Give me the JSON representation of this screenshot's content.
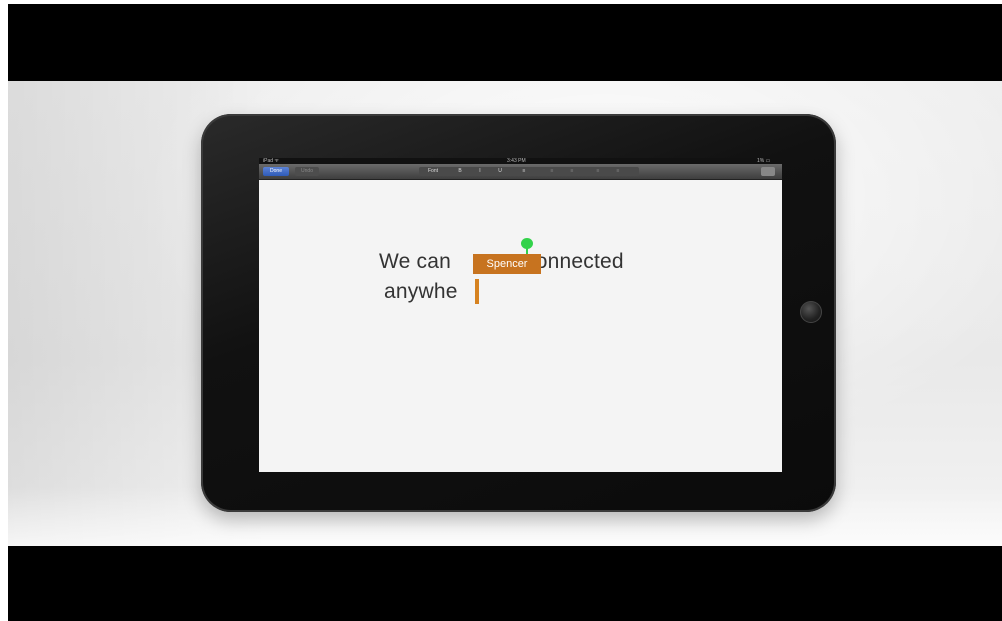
{
  "ipad": {
    "statusbar": {
      "carrier": "iPad ᯤ",
      "time": "3:43 PM",
      "battery": "1% ▭"
    },
    "toolbar": {
      "done_label": "Done",
      "undo_label": "Undo",
      "buttons": [
        "Font",
        "B",
        "I",
        "U",
        "≡",
        "≡",
        "≡",
        "≡",
        "≡"
      ]
    },
    "document": {
      "line1_before": "We can ",
      "line1_after": "connected",
      "line2": "anywhe"
    },
    "collaborator": {
      "name": "Spencer",
      "color": "#c7731f"
    },
    "pin_color": "#32d24a"
  }
}
